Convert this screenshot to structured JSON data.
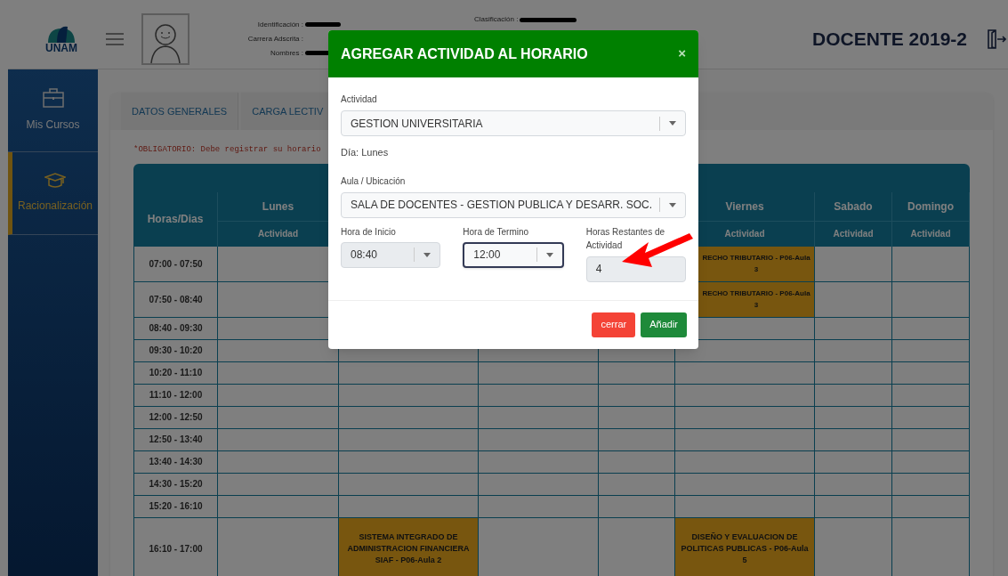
{
  "header": {
    "logo_text": "UNAM",
    "fields": [
      {
        "label": "Identificación :"
      },
      {
        "label": "Carrera Adscrita :"
      },
      {
        "label": "Nombres :"
      },
      {
        "label": "Clasificación :"
      }
    ],
    "role_title": "DOCENTE 2019-2"
  },
  "sidebar": {
    "items": [
      {
        "label": "Mis Cursos",
        "selected": false
      },
      {
        "label": "Racionalización",
        "selected": true
      }
    ]
  },
  "tabs": [
    {
      "label": "DATOS GENERALES"
    },
    {
      "label": "CARGA LECTIV"
    }
  ],
  "notice": "*OBLIGATORIO: Debe registrar su horario",
  "table": {
    "corner": "Horas/Dias",
    "columns": [
      {
        "day": "Lunes",
        "sub": "Actividad"
      },
      {},
      {},
      {},
      {
        "day": "Viernes",
        "sub": "Actividad"
      },
      {
        "day": "Sabado",
        "sub": "Actividad"
      },
      {
        "day": "Domingo",
        "sub": "Actividad"
      }
    ],
    "rows": [
      {
        "time": "07:00 - 07:50",
        "cells": [
          {},
          {},
          {},
          {},
          {
            "text": "RECHO TRIBUTARIO - P06-Aula 3"
          },
          {},
          {}
        ]
      },
      {
        "time": "07:50 - 08:40",
        "cells": [
          {},
          {},
          {},
          {},
          {
            "text": "RECHO TRIBUTARIO - P06-Aula 3"
          },
          {},
          {}
        ]
      },
      {
        "time": "08:40 - 09:30",
        "cells": [
          {},
          {},
          {},
          {},
          {},
          {},
          {}
        ]
      },
      {
        "time": "09:30 - 10:20",
        "cells": [
          {},
          {},
          {},
          {},
          {},
          {},
          {}
        ]
      },
      {
        "time": "10:20 - 11:10",
        "cells": [
          {},
          {},
          {},
          {},
          {},
          {},
          {}
        ]
      },
      {
        "time": "11:10 - 12:00",
        "cells": [
          {},
          {},
          {},
          {},
          {},
          {},
          {}
        ]
      },
      {
        "time": "12:00 - 12:50",
        "cells": [
          {},
          {},
          {},
          {},
          {},
          {},
          {}
        ]
      },
      {
        "time": "12:50 - 13:40",
        "cells": [
          {},
          {},
          {},
          {},
          {},
          {},
          {}
        ]
      },
      {
        "time": "13:40 - 14:30",
        "cells": [
          {},
          {},
          {},
          {},
          {},
          {},
          {}
        ]
      },
      {
        "time": "14:30 - 15:20",
        "cells": [
          {},
          {},
          {},
          {},
          {},
          {},
          {}
        ]
      },
      {
        "time": "15:20 - 16:10",
        "cells": [
          {},
          {},
          {},
          {},
          {},
          {},
          {}
        ]
      },
      {
        "time": "16:10 - 17:00",
        "cells": [
          {},
          {
            "text": "SISTEMA INTEGRADO DE ADMINISTRACION FINANCIERA SIAF - P06-Aula 2"
          },
          {},
          {},
          {
            "text": "DISEÑO Y EVALUACION DE POLITICAS PUBLICAS - P06-Aula 5"
          },
          {},
          {}
        ]
      }
    ]
  },
  "modal": {
    "title": "AGREGAR ACTIVIDAD AL HORARIO",
    "close": "×",
    "activity": {
      "label": "Actividad",
      "value": "GESTION UNIVERSITARIA"
    },
    "day": "Día: Lunes",
    "room": {
      "label": "Aula / Ubicación",
      "value": "SALA DE DOCENTES - GESTION PUBLICA Y DESARR. SOC."
    },
    "start": {
      "label": "Hora de Inicio",
      "value": "08:40",
      "disabled": true
    },
    "end": {
      "label": "Hora de Termino",
      "value": "12:00",
      "focused": true
    },
    "remaining": {
      "label": "Horas Restantes de Actividad",
      "value": "4"
    },
    "buttons": [
      {
        "label": "cerrar",
        "kind": "danger"
      },
      {
        "label": "Añadir",
        "kind": "primary"
      }
    ]
  }
}
